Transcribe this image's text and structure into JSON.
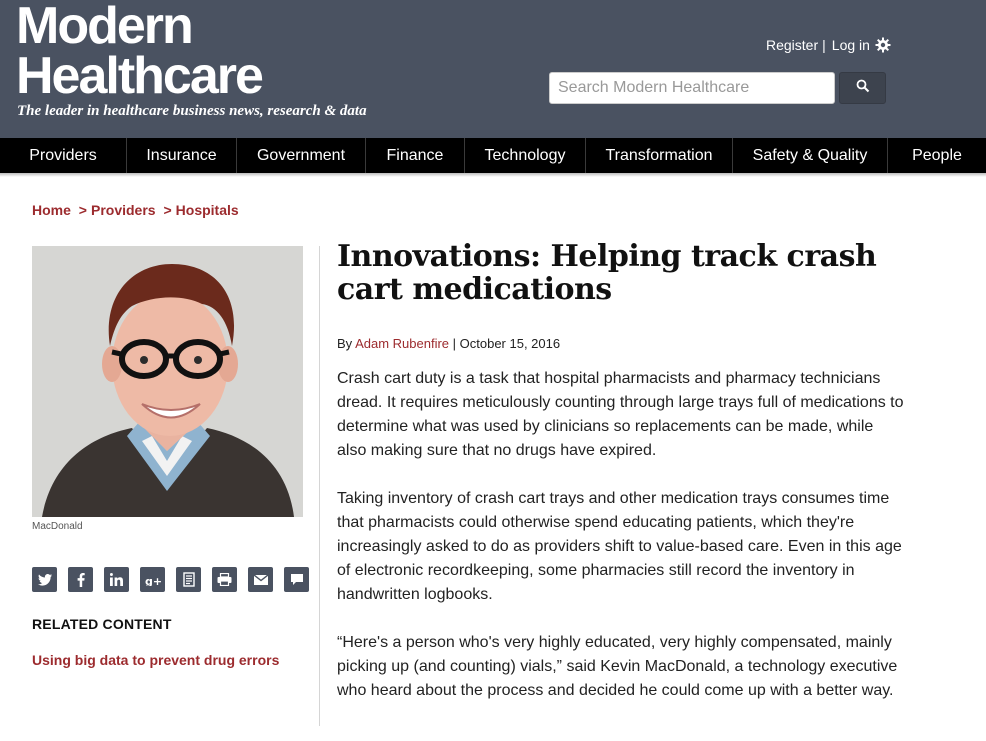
{
  "header": {
    "logo_line1": "Modern",
    "logo_line2": "Healthcare",
    "tagline": "The leader in healthcare business news, research & data",
    "register_label": "Register",
    "separator": "|",
    "login_label": "Log in",
    "search_placeholder": "Search Modern Healthcare"
  },
  "nav": {
    "items": [
      {
        "label": "Providers"
      },
      {
        "label": "Insurance"
      },
      {
        "label": "Government"
      },
      {
        "label": "Finance"
      },
      {
        "label": "Technology"
      },
      {
        "label": "Transformation"
      },
      {
        "label": "Safety & Quality"
      },
      {
        "label": "People"
      }
    ]
  },
  "breadcrumb": {
    "home": "Home",
    "sep": ">",
    "providers": "Providers",
    "hospitals": "Hospitals"
  },
  "photo": {
    "caption": "MacDonald"
  },
  "share": {
    "icons": [
      "twitter-icon",
      "facebook-icon",
      "linkedin-icon",
      "google-plus-icon",
      "reprint-icon",
      "print-icon",
      "email-icon",
      "comment-icon"
    ]
  },
  "related": {
    "title": "RELATED CONTENT",
    "link": "Using big data to prevent drug errors"
  },
  "article": {
    "headline": "Innovations: Helping track crash cart medications",
    "by_label": "By",
    "author": "Adam Rubenfire",
    "date": "| October 15, 2016",
    "paragraphs": [
      "Crash cart duty is a task that hospital pharmacists and pharmacy technicians dread. It requires meticulously counting through large trays full of medications to determine what was used by clinicians so replacements can be made, while also making sure that no drugs have expired.",
      "Taking inventory of crash cart trays and other medication trays consumes time that pharmacists could otherwise spend educating patients, which they're increasingly asked to do as providers shift to value-based care. Even in this age of electronic recordkeeping, some pharmacies still record the inventory in handwritten logbooks.",
      "“Here's a person who's very highly educated, very highly compensated, mainly picking up (and counting) vials,” said Kevin MacDonald, a technology executive who heard about the process and decided he could come up with a better way."
    ]
  },
  "colors": {
    "masthead": "#4a5261",
    "nav": "#000000",
    "accent": "#9c2b2e"
  }
}
